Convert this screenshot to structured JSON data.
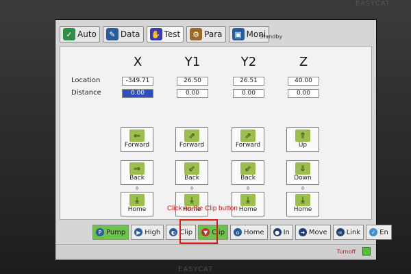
{
  "bezel": {
    "brand_top": "EASYCAT",
    "brand_bottom": "EASYCAT"
  },
  "tabs": [
    {
      "label": "Auto",
      "icon": "check-circle-icon",
      "color": "#2f8f47"
    },
    {
      "label": "Data",
      "icon": "edit-icon",
      "color": "#2a5b9b"
    },
    {
      "label": "Test",
      "icon": "hand-icon",
      "color": "#3a3ab6"
    },
    {
      "label": "Para",
      "icon": "gear-icon",
      "color": "#9b6a2a"
    },
    {
      "label": "Moni",
      "icon": "monitor-icon",
      "color": "#2a5b9b"
    }
  ],
  "status": "Standby",
  "axes": [
    "X",
    "Y1",
    "Y2",
    "Z"
  ],
  "labels": {
    "location": "Location",
    "distance": "Distance"
  },
  "location": [
    "-349.71",
    "26.50",
    "26.51",
    "40.00"
  ],
  "distance": [
    "0.00",
    "0.00",
    "0.00",
    "0.00"
  ],
  "buttons_row1": [
    "Forward",
    "Forward",
    "Forward",
    "Up"
  ],
  "buttons_row2": [
    "Back",
    "Back",
    "Back",
    "Down"
  ],
  "buttons_row3": [
    "Home",
    "Home",
    "Home",
    "Home"
  ],
  "tick_marks": [
    "0",
    "0",
    "0",
    "0"
  ],
  "instruction": "Click on the Clip button",
  "toolbar": [
    {
      "label": "Pump",
      "icon": "pump-icon"
    },
    {
      "label": "High",
      "icon": "speed-icon"
    },
    {
      "label": "Clip",
      "icon": "clip-icon"
    },
    {
      "label": "Clip",
      "icon": "clip-active-icon"
    },
    {
      "label": "Home",
      "icon": "home-icon"
    },
    {
      "label": "In",
      "icon": "in-icon"
    },
    {
      "label": "Move",
      "icon": "move-icon"
    },
    {
      "label": "Link",
      "icon": "link-icon"
    },
    {
      "label": "En",
      "icon": "enable-icon"
    }
  ],
  "footer": {
    "turnoff": "Turnoff"
  },
  "colors": {
    "green": "#6cc24a",
    "highlight": "#e01818",
    "accent": "#9bbf4a"
  }
}
